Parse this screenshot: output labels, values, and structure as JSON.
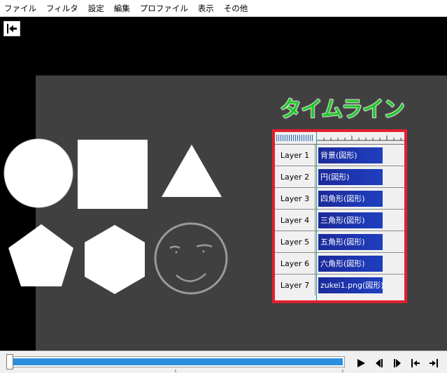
{
  "menu": {
    "items": [
      {
        "label": "ファイル"
      },
      {
        "label": "フィルタ"
      },
      {
        "label": "設定"
      },
      {
        "label": "編集"
      },
      {
        "label": "プロファイル"
      },
      {
        "label": "表示"
      },
      {
        "label": "その他"
      }
    ]
  },
  "toolbar": {
    "back_icon": "jump-to-start-icon"
  },
  "canvas": {
    "background": "#404040",
    "shapes": [
      "circle",
      "square",
      "triangle",
      "pentagon",
      "hexagon",
      "smiley-face"
    ]
  },
  "timeline": {
    "title": "タイムライン",
    "title_color": "#22c52a",
    "highlight_color": "#e02030",
    "layers": [
      {
        "label": "Layer 1",
        "clip": "背景(図形)"
      },
      {
        "label": "Layer 2",
        "clip": "円(図形)"
      },
      {
        "label": "Layer 3",
        "clip": "四角形(図形)"
      },
      {
        "label": "Layer 4",
        "clip": "三角形(図形)"
      },
      {
        "label": "Layer 5",
        "clip": "五角形(図形)"
      },
      {
        "label": "Layer 6",
        "clip": "六角形(図形)"
      },
      {
        "label": "Layer 7",
        "clip": "zukei1.png(図形)"
      }
    ]
  },
  "seekbar": {
    "progress": 1.0,
    "fill_color": "#2b8fe0"
  },
  "transport": {
    "buttons": [
      "play-icon",
      "step-back-icon",
      "step-forward-icon",
      "go-to-start-icon",
      "go-to-end-icon"
    ]
  }
}
